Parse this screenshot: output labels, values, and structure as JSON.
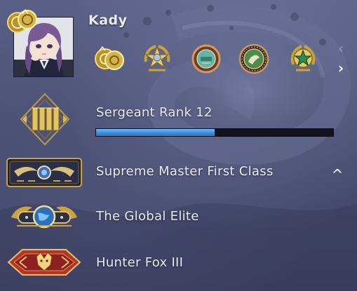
{
  "profile": {
    "username": "Kady",
    "avatar_icon": "anime-avatar-icon",
    "top_coin_icon": "gold-coin-icon"
  },
  "badges": [
    {
      "icon": "gold-coin-pair-icon"
    },
    {
      "icon": "star-laurel-icon"
    },
    {
      "icon": "teal-pin-icon"
    },
    {
      "icon": "green-medal-icon"
    },
    {
      "icon": "green-star-medal-icon"
    }
  ],
  "navigation": {
    "prev_label": "‹",
    "next_label": "›"
  },
  "xp_rank": {
    "label": "Sergeant Rank 12",
    "progress": 0.5,
    "icon": "sergeant-chevron-icon"
  },
  "ranks": [
    {
      "label": "Supreme Master First Class",
      "icon": "supreme-wings-icon"
    },
    {
      "label": "The Global Elite",
      "icon": "global-elite-icon"
    },
    {
      "label": "Hunter Fox III",
      "icon": "hunter-fox-icon"
    }
  ],
  "collapse_label": "^",
  "colors": {
    "progress": "#3a8fde",
    "background": "#4a4e72",
    "gold": "#d4b44a"
  }
}
